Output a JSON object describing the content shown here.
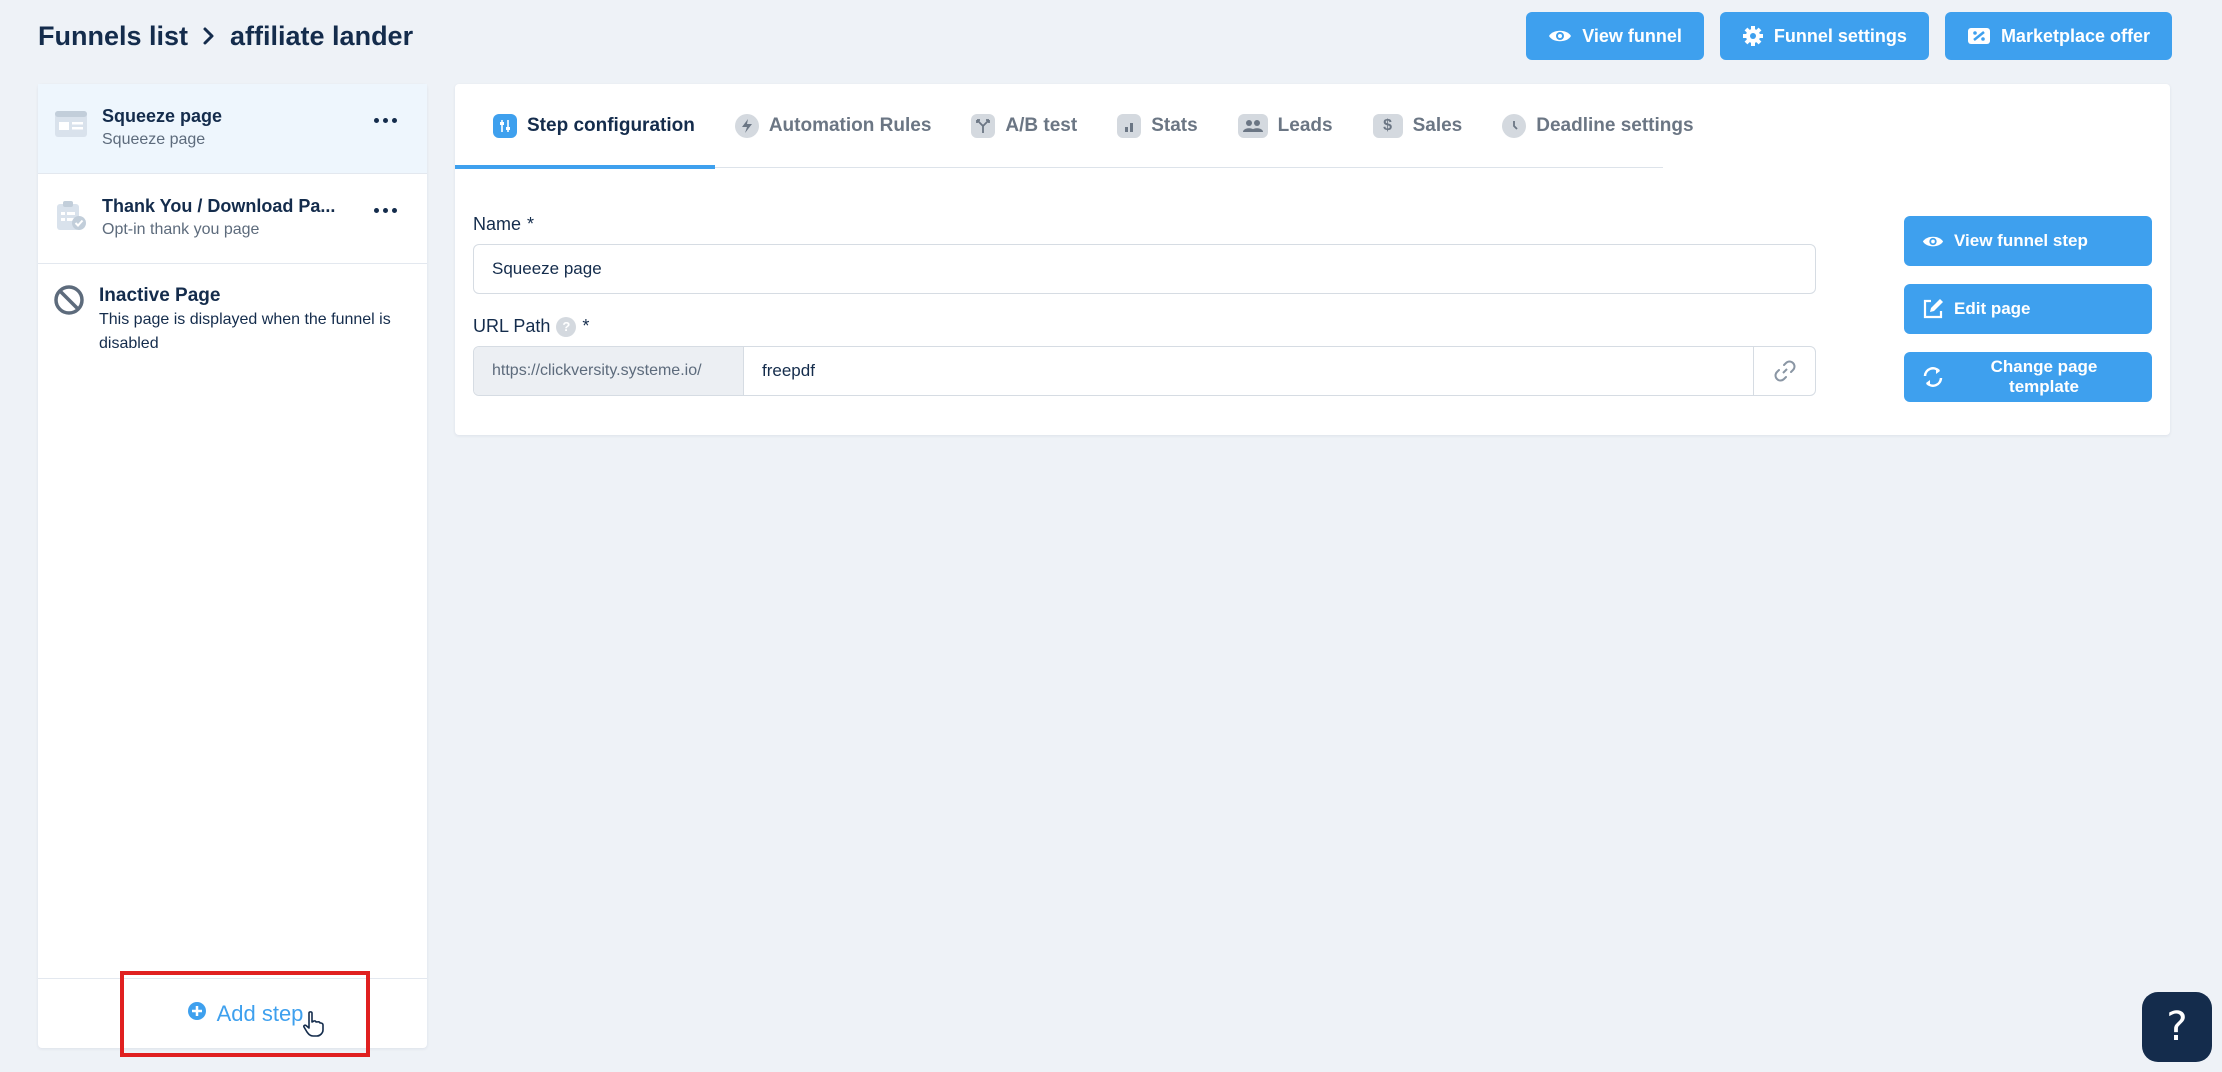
{
  "header": {
    "breadcrumb_root": "Funnels list",
    "breadcrumb_current": "affiliate lander",
    "actions": {
      "view_funnel": "View funnel",
      "funnel_settings": "Funnel settings",
      "marketplace_offer": "Marketplace offer"
    }
  },
  "sidebar": {
    "steps": [
      {
        "title": "Squeeze page",
        "subtitle": "Squeeze page"
      },
      {
        "title": "Thank You / Download Pa...",
        "subtitle": "Opt-in thank you page"
      }
    ],
    "inactive": {
      "title": "Inactive Page",
      "description": "This page is displayed when the funnel is disabled"
    },
    "add_step": "Add step"
  },
  "tabs": [
    {
      "label": "Step configuration",
      "active": true
    },
    {
      "label": "Automation Rules"
    },
    {
      "label": "A/B test"
    },
    {
      "label": "Stats"
    },
    {
      "label": "Leads"
    },
    {
      "label": "Sales"
    },
    {
      "label": "Deadline settings"
    }
  ],
  "form": {
    "name_label": "Name",
    "name_required": "*",
    "name_value": "Squeeze page",
    "url_label": "URL Path",
    "url_help": "?",
    "url_required": "*",
    "url_prefix": "https://clickversity.systeme.io/",
    "url_value": "freepdf"
  },
  "side_actions": {
    "view_funnel_step": "View funnel step",
    "edit_page": "Edit page",
    "change_page_template": "Change page template"
  },
  "help_fab": "?",
  "colors": {
    "accent": "#3ea0ee",
    "text_dark": "#142c4c",
    "highlight_box": "#e02020",
    "background": "#eef2f7"
  }
}
